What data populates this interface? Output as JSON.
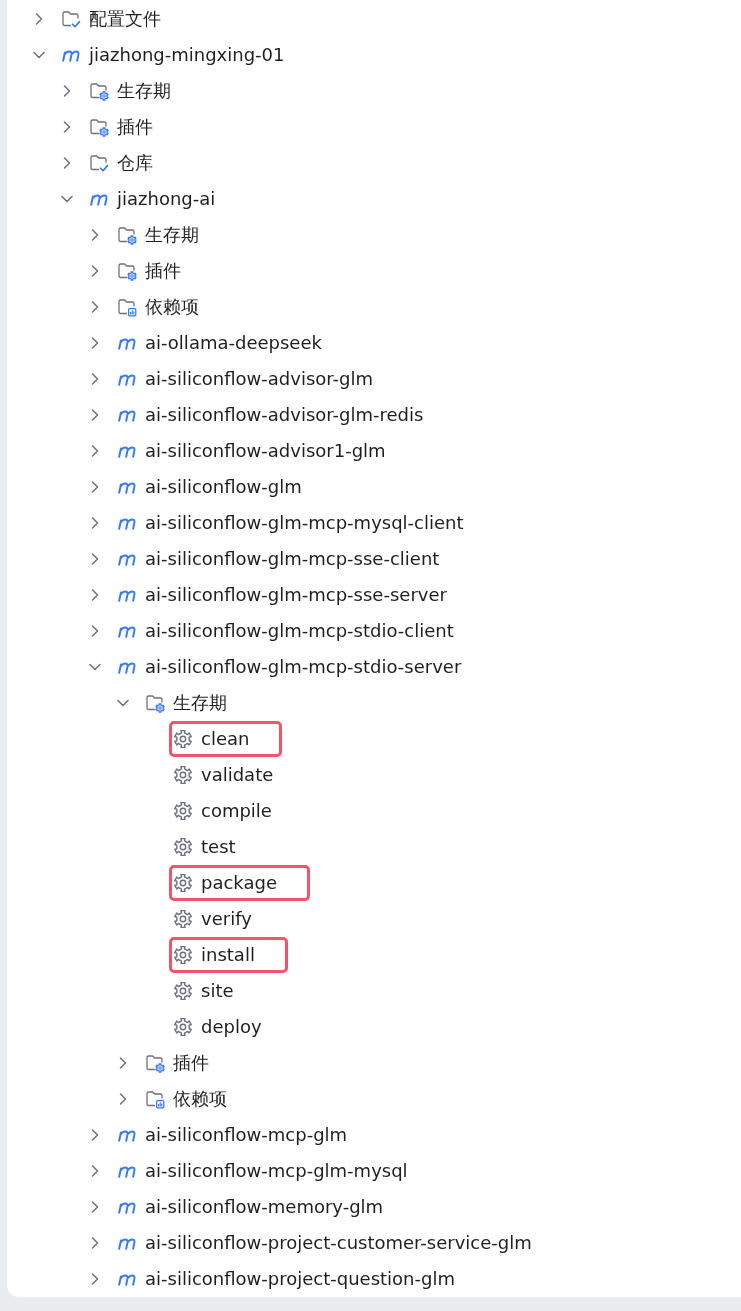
{
  "tree": [
    {
      "kind": "profiles",
      "label": "配置文件",
      "expanded": false
    },
    {
      "kind": "module",
      "label": "jiazhong-mingxing-01",
      "expanded": true,
      "children": [
        {
          "kind": "lifecycle",
          "label": "生存期",
          "expanded": false
        },
        {
          "kind": "plugins",
          "label": "插件",
          "expanded": false
        },
        {
          "kind": "repositories",
          "label": "仓库",
          "expanded": false
        },
        {
          "kind": "module",
          "label": "jiazhong-ai",
          "expanded": true,
          "children": [
            {
              "kind": "lifecycle",
              "label": "生存期",
              "expanded": false
            },
            {
              "kind": "plugins",
              "label": "插件",
              "expanded": false
            },
            {
              "kind": "dependencies",
              "label": "依赖项",
              "expanded": false
            },
            {
              "kind": "module",
              "label": "ai-ollama-deepseek",
              "expanded": false
            },
            {
              "kind": "module",
              "label": "ai-siliconflow-advisor-glm",
              "expanded": false
            },
            {
              "kind": "module",
              "label": "ai-siliconflow-advisor-glm-redis",
              "expanded": false
            },
            {
              "kind": "module",
              "label": "ai-siliconflow-advisor1-glm",
              "expanded": false
            },
            {
              "kind": "module",
              "label": "ai-siliconflow-glm",
              "expanded": false
            },
            {
              "kind": "module",
              "label": "ai-siliconflow-glm-mcp-mysql-client",
              "expanded": false
            },
            {
              "kind": "module",
              "label": "ai-siliconflow-glm-mcp-sse-client",
              "expanded": false
            },
            {
              "kind": "module",
              "label": "ai-siliconflow-glm-mcp-sse-server",
              "expanded": false
            },
            {
              "kind": "module",
              "label": "ai-siliconflow-glm-mcp-stdio-client",
              "expanded": false
            },
            {
              "kind": "module",
              "label": "ai-siliconflow-glm-mcp-stdio-server",
              "expanded": true,
              "children": [
                {
                  "kind": "lifecycle",
                  "label": "生存期",
                  "expanded": true,
                  "children": [
                    {
                      "kind": "goal",
                      "label": "clean",
                      "highlighted": true
                    },
                    {
                      "kind": "goal",
                      "label": "validate",
                      "highlighted": false
                    },
                    {
                      "kind": "goal",
                      "label": "compile",
                      "highlighted": false
                    },
                    {
                      "kind": "goal",
                      "label": "test",
                      "highlighted": false
                    },
                    {
                      "kind": "goal",
                      "label": "package",
                      "highlighted": true
                    },
                    {
                      "kind": "goal",
                      "label": "verify",
                      "highlighted": false
                    },
                    {
                      "kind": "goal",
                      "label": "install",
                      "highlighted": true
                    },
                    {
                      "kind": "goal",
                      "label": "site",
                      "highlighted": false
                    },
                    {
                      "kind": "goal",
                      "label": "deploy",
                      "highlighted": false
                    }
                  ]
                },
                {
                  "kind": "plugins",
                  "label": "插件",
                  "expanded": false
                },
                {
                  "kind": "dependencies",
                  "label": "依赖项",
                  "expanded": false
                }
              ]
            },
            {
              "kind": "module",
              "label": "ai-siliconflow-mcp-glm",
              "expanded": false
            },
            {
              "kind": "module",
              "label": "ai-siliconflow-mcp-glm-mysql",
              "expanded": false
            },
            {
              "kind": "module",
              "label": "ai-siliconflow-memory-glm",
              "expanded": false
            },
            {
              "kind": "module",
              "label": "ai-siliconflow-project-customer-service-glm",
              "expanded": false
            },
            {
              "kind": "module",
              "label": "ai-siliconflow-project-question-glm",
              "expanded": false
            }
          ]
        }
      ]
    }
  ]
}
